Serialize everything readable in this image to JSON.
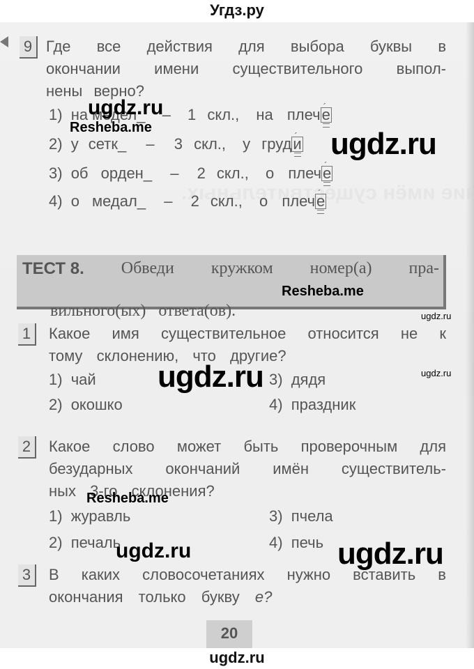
{
  "header": {
    "site_title": "Угдз.ру"
  },
  "footer": {
    "site_url": "ugdz.ru"
  },
  "question9": {
    "number": "9",
    "lines": [
      [
        "Где",
        "все",
        "действия",
        "для",
        "выбора",
        "буквы",
        "в"
      ],
      [
        "окончании",
        "имени",
        "существительного",
        "выпол-"
      ],
      [
        "нены",
        "верно?"
      ]
    ],
    "options": [
      {
        "label": "1)",
        "phrase": "на медел_",
        "dash": "–",
        "decl": "1 скл.,",
        "check_prefix": "на плеч",
        "check_letter": "е"
      },
      {
        "label": "2)",
        "phrase": "у сетк_",
        "dash": "–",
        "decl": "3 скл.,",
        "check_prefix": "у груд",
        "check_letter": "и"
      },
      {
        "label": "3)",
        "phrase": "об орден_",
        "dash": "–",
        "decl": "2 скл.,",
        "check_prefix": "о плеч",
        "check_letter": "е"
      },
      {
        "label": "4)",
        "phrase": "о медал_",
        "dash": "–",
        "decl": "2 скл.,",
        "check_prefix": "о плеч",
        "check_letter": "е"
      }
    ],
    "accent_mark": "´"
  },
  "test": {
    "title": "ТЕСТ 8.",
    "line1_words": [
      "Обведи",
      "кружком",
      "номер(а)",
      "пра-"
    ],
    "line2": "вильного(ых)   ответа(ов)."
  },
  "question1": {
    "number": "1",
    "lines": [
      [
        "Какое",
        "имя",
        "существительное",
        "относится",
        "не",
        "к"
      ],
      [
        "тому",
        "склонению,",
        "что",
        "другие?"
      ]
    ],
    "options": [
      {
        "label": "1)",
        "text": "чай"
      },
      {
        "label": "2)",
        "text": "окошко"
      },
      {
        "label": "3)",
        "text": "дядя"
      },
      {
        "label": "4)",
        "text": "праздник"
      }
    ]
  },
  "question2": {
    "number": "2",
    "lines": [
      [
        "Какое",
        "слово",
        "может",
        "быть",
        "проверочным",
        "для"
      ],
      [
        "безударных",
        "окончаний",
        "имён",
        "существитель-"
      ],
      [
        "ных",
        "3-го",
        "склонения?"
      ]
    ],
    "options": [
      {
        "label": "1)",
        "text": "журавль"
      },
      {
        "label": "2)",
        "text": "печаль"
      },
      {
        "label": "3)",
        "text": "пчела"
      },
      {
        "label": "4)",
        "text": "печь"
      }
    ]
  },
  "question3": {
    "number": "3",
    "lines": [
      [
        "В",
        "каких",
        "словосочетаниях",
        "нужно",
        "вставить",
        "в"
      ],
      [
        "окончания",
        "только",
        "букву",
        "е?"
      ]
    ]
  },
  "page_number": "20",
  "watermarks": {
    "ugdz": "ugdz.ru",
    "resheba": "Resheba.me"
  }
}
